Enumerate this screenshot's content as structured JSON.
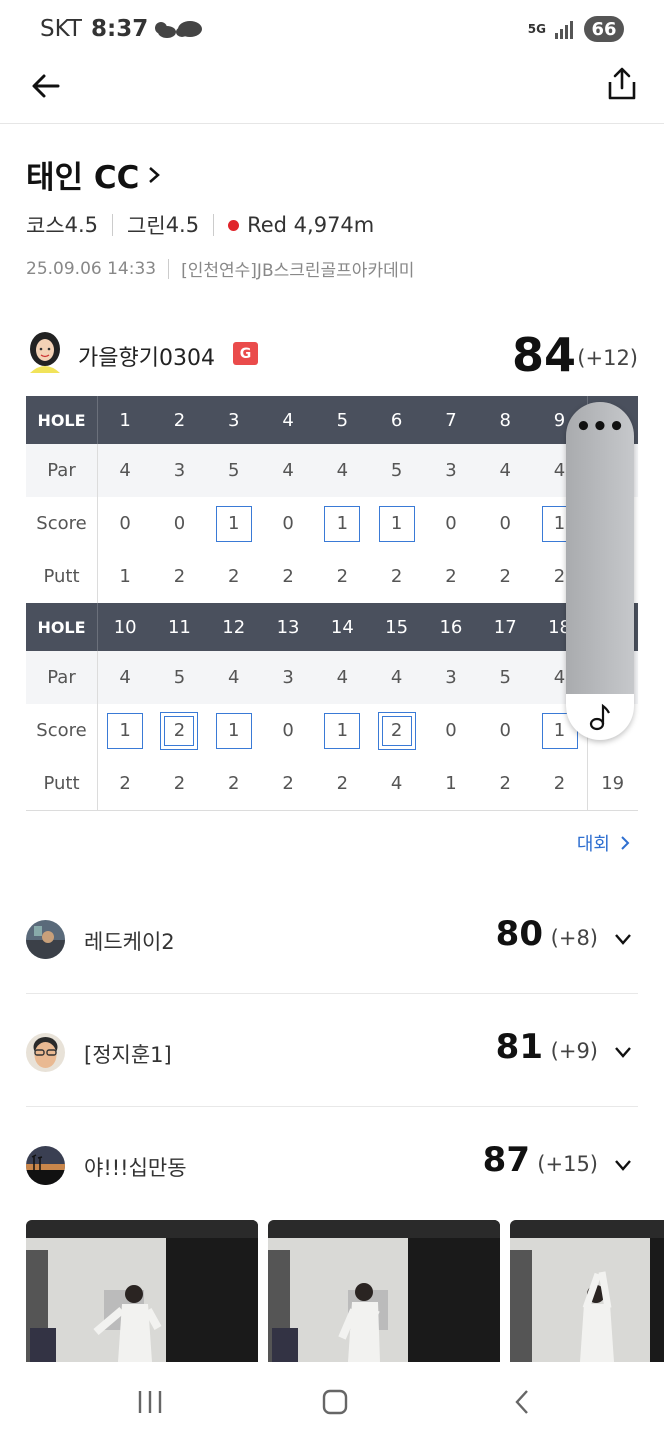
{
  "status_bar": {
    "carrier": "SKT",
    "time": "8:37",
    "network": "5G",
    "battery": "66"
  },
  "course": {
    "name": "태인 CC",
    "course_rating_label": "코스",
    "course_rating": "4.5",
    "green_rating_label": "그린",
    "green_rating": "4.5",
    "tee": "Red 4,974m",
    "datetime": "25.09.06 14:33",
    "venue": "[인천연수]JB스크린골프아카데미"
  },
  "player": {
    "name": "가을향기0304",
    "badge": "G",
    "total": "84",
    "diff": "(+12)"
  },
  "scorecard": {
    "labels": {
      "hole": "HOLE",
      "par": "Par",
      "score": "Score",
      "putt": "Putt"
    },
    "front": {
      "holes": [
        "1",
        "2",
        "3",
        "4",
        "5",
        "6",
        "7",
        "8",
        "9"
      ],
      "par": [
        "4",
        "3",
        "5",
        "4",
        "4",
        "5",
        "3",
        "4",
        "4"
      ],
      "score": [
        "0",
        "0",
        "1",
        "0",
        "1",
        "1",
        "0",
        "0",
        "1"
      ],
      "putt": [
        "1",
        "2",
        "2",
        "2",
        "2",
        "2",
        "2",
        "2",
        "2"
      ],
      "total_putt": ""
    },
    "back": {
      "holes": [
        "10",
        "11",
        "12",
        "13",
        "14",
        "15",
        "16",
        "17",
        "18"
      ],
      "par": [
        "4",
        "5",
        "4",
        "3",
        "4",
        "4",
        "3",
        "5",
        "4"
      ],
      "score": [
        "1",
        "2",
        "1",
        "0",
        "1",
        "2",
        "0",
        "0",
        "1"
      ],
      "putt": [
        "2",
        "2",
        "2",
        "2",
        "2",
        "4",
        "1",
        "2",
        "2"
      ],
      "total_putt": "19"
    }
  },
  "floating": {
    "more": "•••"
  },
  "tournament_link": "대회",
  "other_players": [
    {
      "name": "레드케이2",
      "total": "80",
      "diff": "(+8)"
    },
    {
      "name": "[정지훈1]",
      "total": "81",
      "diff": "(+9)"
    },
    {
      "name": "야!!!십만동",
      "total": "87",
      "diff": "(+15)"
    }
  ],
  "colors": {
    "accent": "#3a7ad6",
    "header": "#4a505d",
    "badge": "#ea4b4b",
    "link": "#2f6fd0"
  }
}
